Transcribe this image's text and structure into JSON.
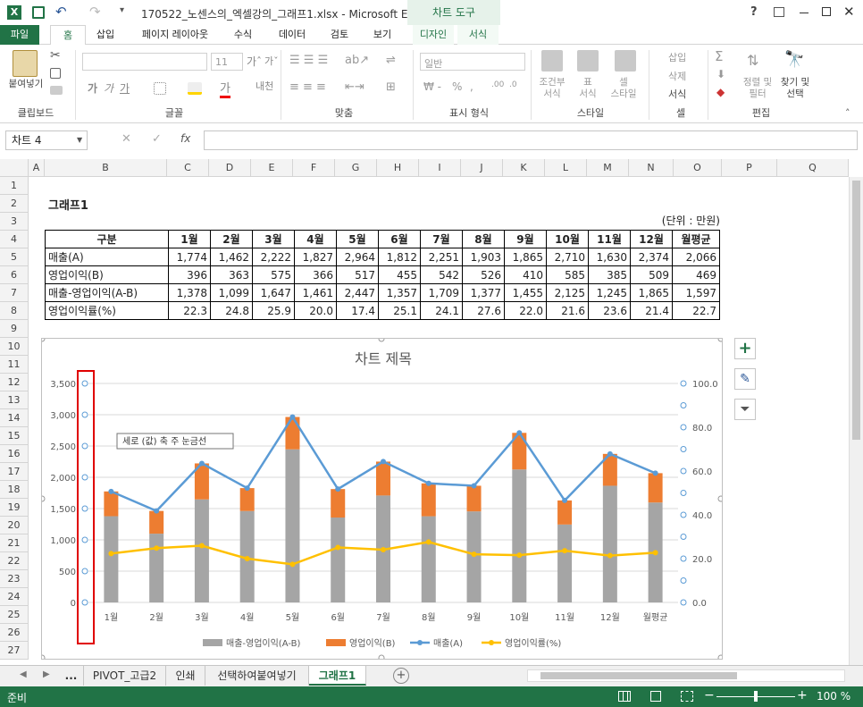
{
  "window": {
    "title": "170522_노센스의_엑셀강의_그래프1.xlsx - Microsoft Excel",
    "context_tab": "차트 도구",
    "help": "?"
  },
  "ribbon_tabs": [
    "파일",
    "홈",
    "삽입",
    "페이지 레이아웃",
    "수식",
    "데이터",
    "검토",
    "보기",
    "디자인",
    "서식"
  ],
  "ribbon": {
    "groups": [
      "클립보드",
      "글꼴",
      "맞춤",
      "표시 형식",
      "스타일",
      "셀",
      "편집"
    ],
    "paste": "붙여넣기",
    "font_size": "11",
    "number_format": "일반",
    "cond_format": "조건부\n서식",
    "table_format": "표\n서식",
    "cell_style": "셀\n스타일",
    "insert": "삽입",
    "delete": "삭제",
    "format": "서식",
    "sort": "정렬 및\n필터",
    "find": "찾기 및\n선택"
  },
  "namebox": "차트 4",
  "columns": [
    "A",
    "B",
    "C",
    "D",
    "E",
    "F",
    "G",
    "H",
    "I",
    "J",
    "K",
    "L",
    "M",
    "N",
    "O",
    "P",
    "Q"
  ],
  "rows": [
    "1",
    "2",
    "3",
    "4",
    "5",
    "6",
    "7",
    "8",
    "9",
    "10",
    "11",
    "12",
    "13",
    "14",
    "15",
    "16",
    "17",
    "18",
    "19",
    "20",
    "21",
    "22",
    "23",
    "24",
    "25",
    "26",
    "27"
  ],
  "sheet": {
    "title": "그래프1",
    "unit": "(단위 : 만원)",
    "header": [
      "구분",
      "1월",
      "2월",
      "3월",
      "4월",
      "5월",
      "6월",
      "7월",
      "8월",
      "9월",
      "10월",
      "11월",
      "12월",
      "월평균"
    ],
    "table": [
      [
        "매출(A)",
        "1,774",
        "1,462",
        "2,222",
        "1,827",
        "2,964",
        "1,812",
        "2,251",
        "1,903",
        "1,865",
        "2,710",
        "1,630",
        "2,374",
        "2,066"
      ],
      [
        "영업이익(B)",
        "396",
        "363",
        "575",
        "366",
        "517",
        "455",
        "542",
        "526",
        "410",
        "585",
        "385",
        "509",
        "469"
      ],
      [
        "매출-영업이익(A-B)",
        "1,378",
        "1,099",
        "1,647",
        "1,461",
        "2,447",
        "1,357",
        "1,709",
        "1,377",
        "1,455",
        "2,125",
        "1,245",
        "1,865",
        "1,597"
      ],
      [
        "영업이익률(%)",
        "22.3",
        "24.8",
        "25.9",
        "20.0",
        "17.4",
        "25.1",
        "24.1",
        "27.6",
        "22.0",
        "21.6",
        "23.6",
        "21.4",
        "22.7"
      ]
    ]
  },
  "chart_data": {
    "type": "bar",
    "title": "차트 제목",
    "categories": [
      "1월",
      "2월",
      "3월",
      "4월",
      "5월",
      "6월",
      "7월",
      "8월",
      "9월",
      "10월",
      "11월",
      "12월",
      "월평균"
    ],
    "series": [
      {
        "name": "매출-영업이익(A-B)",
        "kind": "stacked-bar",
        "color": "#a5a5a5",
        "values": [
          1378,
          1099,
          1647,
          1461,
          2447,
          1357,
          1709,
          1377,
          1455,
          2125,
          1245,
          1865,
          1597
        ]
      },
      {
        "name": "영업이익(B)",
        "kind": "stacked-bar",
        "color": "#ed7d31",
        "values": [
          396,
          363,
          575,
          366,
          517,
          455,
          542,
          526,
          410,
          585,
          385,
          509,
          469
        ]
      },
      {
        "name": "매출(A)",
        "kind": "line",
        "color": "#5b9bd5",
        "values": [
          1774,
          1462,
          2222,
          1827,
          2964,
          1812,
          2251,
          1903,
          1865,
          2710,
          1630,
          2374,
          2066
        ]
      },
      {
        "name": "영업이익률(%)",
        "kind": "line-secondary",
        "color": "#ffc000",
        "values": [
          22.3,
          24.8,
          25.9,
          20.0,
          17.4,
          25.1,
          24.1,
          27.6,
          22.0,
          21.6,
          23.6,
          21.4,
          22.7
        ]
      }
    ],
    "y_ticks": [
      "0",
      "500",
      "1,000",
      "1,500",
      "2,000",
      "2,500",
      "3,000",
      "3,500"
    ],
    "ylim": [
      0,
      3500
    ],
    "y2_ticks": [
      "0.0",
      "20.0",
      "40.0",
      "60.0",
      "80.0",
      "100.0"
    ],
    "y2lim": [
      0,
      100
    ],
    "legend_position": "bottom",
    "grid": true,
    "tooltip": "세로 (값) 축 주 눈금선"
  },
  "sheet_tabs": [
    "...",
    "PIVOT_고급2",
    "인쇄",
    "선택하여붙여넣기",
    "그래프1"
  ],
  "status": {
    "ready": "준비",
    "zoom": "100 %"
  },
  "colors": {
    "excel_green": "#217346",
    "selection_red": "#e00000"
  }
}
